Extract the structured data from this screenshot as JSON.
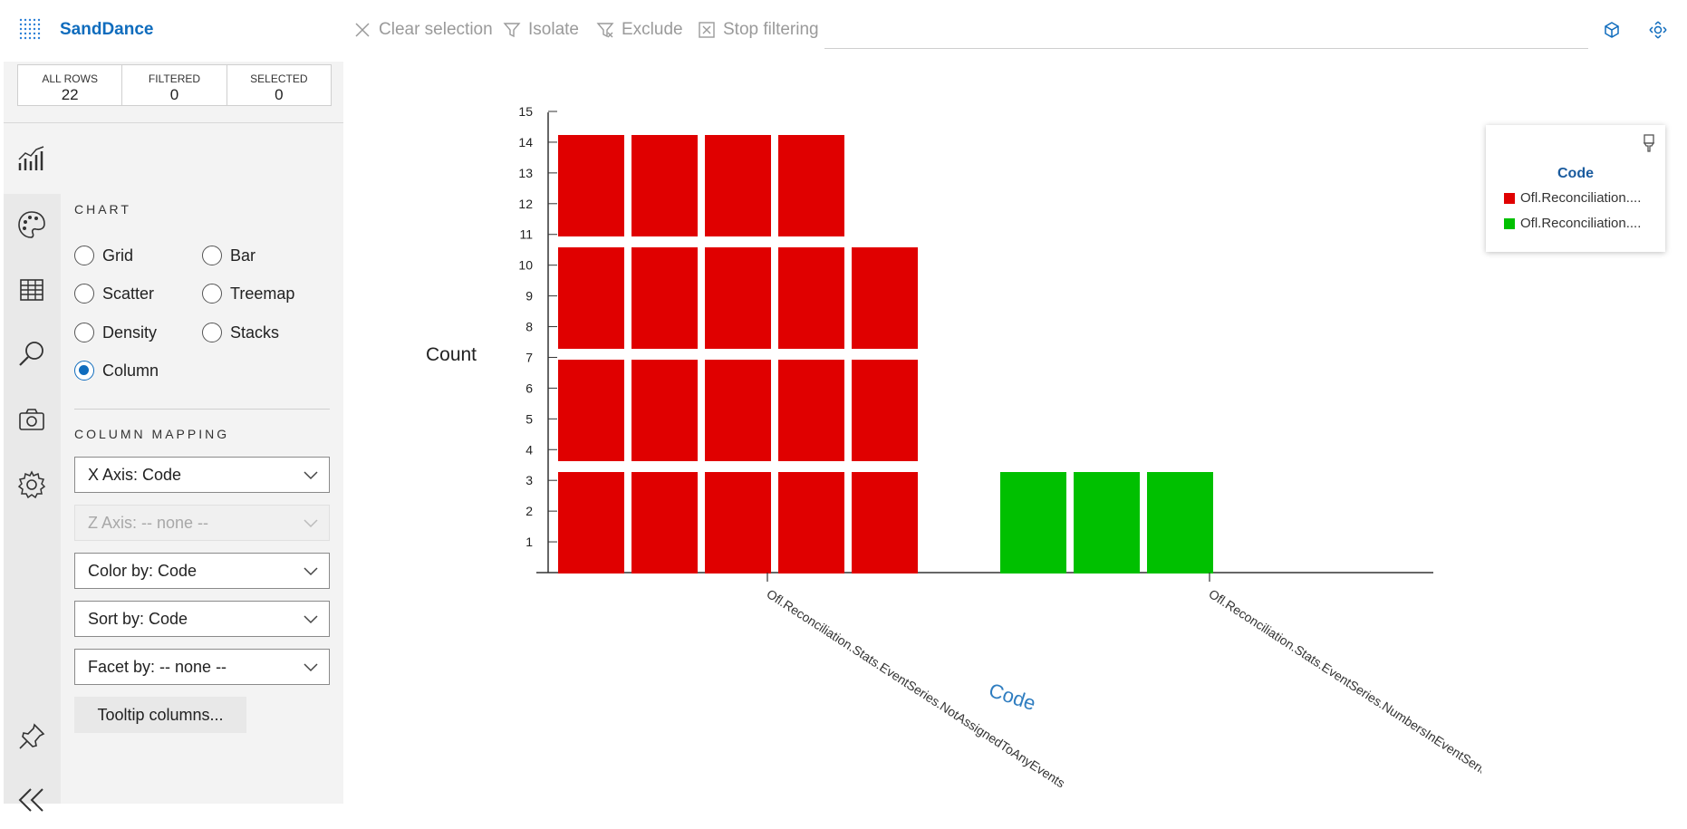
{
  "app": {
    "title": "SandDance"
  },
  "toolbar": {
    "clear_selection": "Clear selection",
    "isolate": "Isolate",
    "exclude": "Exclude",
    "stop_filtering": "Stop filtering",
    "icons": [
      "close-icon",
      "funnel-icon",
      "funnel-x-icon",
      "stop-filter-icon",
      "cube-icon",
      "fit-view-icon"
    ]
  },
  "counts": {
    "all_rows_label": "ALL ROWS",
    "all_rows_value": "22",
    "filtered_label": "FILTERED",
    "filtered_value": "0",
    "selected_label": "SELECTED",
    "selected_value": "0"
  },
  "sidebar": {
    "rail_icons": [
      "chart-icon",
      "palette-icon",
      "table-icon",
      "search-icon",
      "camera-icon",
      "gear-icon",
      "pin-icon",
      "collapse-icon"
    ],
    "chart_title": "CHART",
    "chart_types": [
      {
        "label": "Grid",
        "selected": false
      },
      {
        "label": "Bar",
        "selected": false
      },
      {
        "label": "Scatter",
        "selected": false
      },
      {
        "label": "Treemap",
        "selected": false
      },
      {
        "label": "Density",
        "selected": false
      },
      {
        "label": "Stacks",
        "selected": false
      },
      {
        "label": "Column",
        "selected": true
      }
    ],
    "mapping_title": "COLUMN MAPPING",
    "x_axis": "X Axis: Code",
    "z_axis": "Z Axis: -- none --",
    "color_by": "Color by: Code",
    "sort_by": "Sort by: Code",
    "facet_by": "Facet by: -- none --",
    "tooltip_button": "Tooltip columns..."
  },
  "legend": {
    "title": "Code",
    "items": [
      {
        "label": "Ofl.Reconciliation....",
        "color": "#e00000"
      },
      {
        "label": "Ofl.Reconciliation....",
        "color": "#00c000"
      }
    ]
  },
  "chart_data": {
    "type": "bar",
    "layout": "stacked unit columns",
    "categories": [
      "Ofl.Reconciliation.Stats.EventSeries.NotAssignedToAnyEvents",
      "Ofl.Reconciliation.Stats.EventSeries.NumbersInEventSeriesDescription"
    ],
    "values": [
      19,
      3
    ],
    "colors": [
      "#e00000",
      "#00c000"
    ],
    "xlabel": "Code",
    "ylabel": "Count",
    "yticks": [
      "1",
      "2",
      "3",
      "4",
      "5",
      "6",
      "7",
      "8",
      "9",
      "10",
      "11",
      "12",
      "13",
      "14",
      "15"
    ],
    "ylim": [
      0,
      15
    ]
  }
}
